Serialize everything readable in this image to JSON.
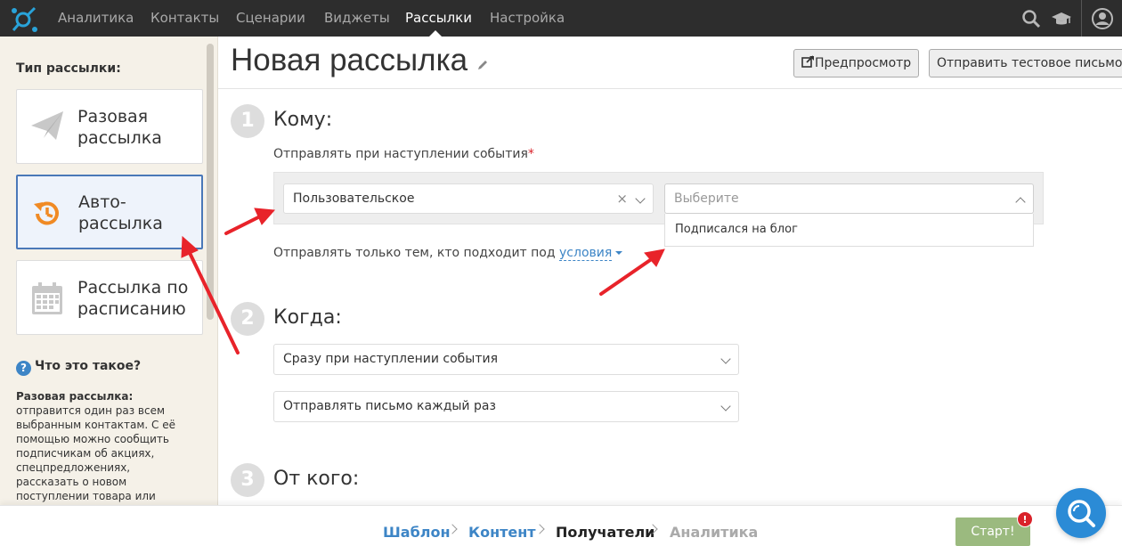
{
  "nav": {
    "items": [
      {
        "label": "Аналитика",
        "active": false
      },
      {
        "label": "Контакты",
        "active": false
      },
      {
        "label": "Сценарии",
        "active": false
      },
      {
        "label": "Виджеты",
        "active": false
      },
      {
        "label": "Рассылки",
        "active": true
      },
      {
        "label": "Настройка",
        "active": false
      }
    ],
    "icons": [
      "search-icon",
      "graduation-cap-icon",
      "user-icon"
    ]
  },
  "sidebar": {
    "heading": "Тип рассылки:",
    "types": [
      {
        "label": "Разовая рассылка",
        "icon": "paper-plane-icon",
        "active": false
      },
      {
        "label": "Авто-рассылка",
        "icon": "clock-history-icon",
        "active": true
      },
      {
        "label": "Рассылка по расписанию",
        "icon": "calendar-icon",
        "active": false
      }
    ],
    "help_title": "Что это такое?",
    "help_subtitle": "Разовая рассылка:",
    "help_text": "отправится один раз всем выбранным контактам. С её помощью можно сообщить подписчикам об акциях, спецпредложениях, рассказать о новом поступлении товара или поздравить с праздником."
  },
  "page": {
    "title": "Новая рассылка",
    "preview_label": "Предпросмотр",
    "test_label": "Отправить тестовое письмо"
  },
  "step1": {
    "number": "1",
    "title": "Кому:",
    "event_label": "Отправлять при наступлении события",
    "required_mark": "*",
    "event_type_value": "Пользовательское",
    "event_placeholder": "Выберите",
    "dropdown_option": "Подписался на блог",
    "cond_prefix": "Отправлять только тем, кто подходит под",
    "cond_link": "условия"
  },
  "step2": {
    "number": "2",
    "title": "Когда:",
    "timing_value": "Сразу при наступлении события",
    "frequency_value": "Отправлять письмо каждый раз"
  },
  "step3": {
    "number": "3",
    "title": "От кого:"
  },
  "footer": {
    "steps": [
      {
        "label": "Шаблон",
        "state": "done"
      },
      {
        "label": "Контент",
        "state": "done"
      },
      {
        "label": "Получатели",
        "state": "current"
      },
      {
        "label": "Аналитика",
        "state": "todo"
      }
    ],
    "start_label": "Старт!",
    "badge": "!"
  },
  "colors": {
    "nav_bg": "#2d2d2d",
    "accent": "#3d85c6",
    "active_border": "#4a78b8",
    "annotation_arrow": "#e8232a",
    "start_button": "#9bba7f",
    "sidebar_bg": "#f5f1e8",
    "brand_logo": "#29a3d9"
  }
}
